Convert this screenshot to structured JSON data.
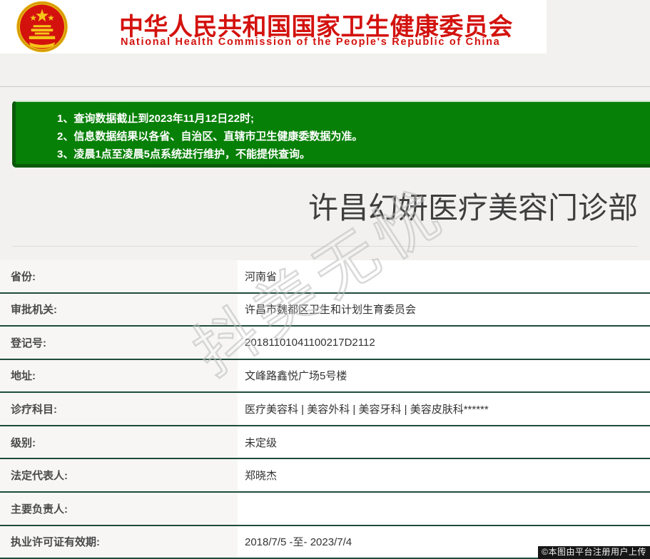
{
  "header": {
    "title_cn": "中华人民共和国国家卫生健康委员会",
    "title_en": "National Health Commission of the People's Republic of China"
  },
  "colors": {
    "brand_red": "#d3120e",
    "notice_green": "#078007",
    "row_divider_green": "#1e4c3a"
  },
  "notice": {
    "items": [
      "1、查询数据截止到2023年11月12日22时;",
      "2、信息数据结果以各省、自治区、直辖市卫生健康委数据为准。",
      "3、凌晨1点至凌晨5点系统进行维护，不能提供查询。"
    ]
  },
  "result": {
    "title": "许昌幻妍医疗美容门诊部"
  },
  "table": {
    "rows": [
      {
        "label": "省份:",
        "value": "河南省"
      },
      {
        "label": "审批机关:",
        "value": "许昌市魏都区卫生和计划生育委员会"
      },
      {
        "label": "登记号:",
        "value": "20181101041100217D2112"
      },
      {
        "label": "地址:",
        "value": "文峰路鑫悦广场5号楼"
      },
      {
        "label": "诊疗科目:",
        "value": "医疗美容科 | 美容外科 | 美容牙科 | 美容皮肤科******"
      },
      {
        "label": "级别:",
        "value": "未定级"
      },
      {
        "label": "法定代表人:",
        "value": "郑晓杰"
      },
      {
        "label": "主要负责人:",
        "value": ""
      },
      {
        "label": "执业许可证有效期:",
        "value": "2018/7/5 -至- 2023/7/4"
      }
    ]
  },
  "watermark": {
    "text": "抖美无忧"
  },
  "footer": {
    "badge": "©本图由平台注册用户上传"
  }
}
